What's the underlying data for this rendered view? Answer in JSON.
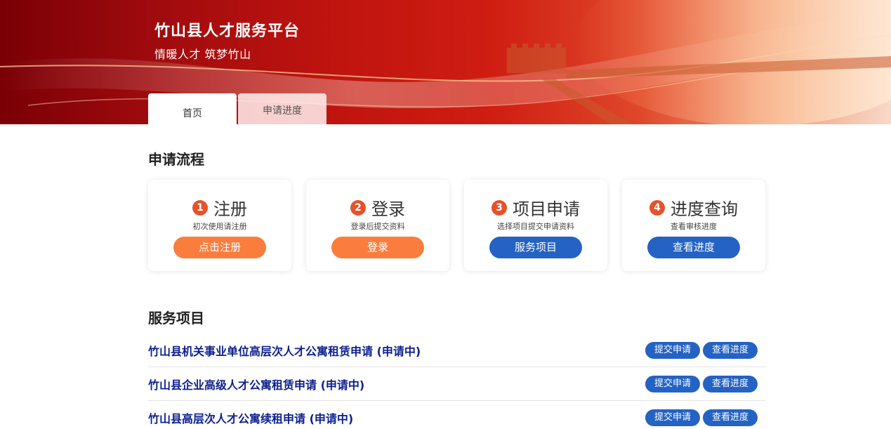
{
  "header": {
    "title": "竹山县人才服务平台",
    "subtitle": "情暖人才 筑梦竹山",
    "tabs": [
      {
        "label": "首页",
        "active": true
      },
      {
        "label": "申请进度",
        "active": false
      }
    ]
  },
  "process": {
    "title": "申请流程",
    "steps": [
      {
        "num": "1",
        "title": "注册",
        "desc": "初次使用请注册",
        "button": "点击注册",
        "color": "#fb7d3e"
      },
      {
        "num": "2",
        "title": "登录",
        "desc": "登录后提交资料",
        "button": "登录",
        "color": "#fb7d3e"
      },
      {
        "num": "3",
        "title": "项目申请",
        "desc": "选择项目提交申请资料",
        "button": "服务项目",
        "color": "#2463c4"
      },
      {
        "num": "4",
        "title": "进度查询",
        "desc": "查看审核进度",
        "button": "查看进度",
        "color": "#2463c4"
      }
    ]
  },
  "services": {
    "title": "服务项目",
    "submit_label": "提交申请",
    "progress_label": "查看进度",
    "items": [
      {
        "name": "竹山县机关事业单位高层次人才公寓租赁申请 (申请中)"
      },
      {
        "name": "竹山县企业高级人才公寓租赁申请 (申请中)"
      },
      {
        "name": "竹山县高层次人才公寓续租申请 (申请中)"
      }
    ]
  },
  "colors": {
    "accent_orange": "#fb7d3e",
    "accent_blue": "#2463c4",
    "step_badge": "#e5522b",
    "link_navy": "#0c1f8f",
    "banner_red": "#c0140f"
  }
}
